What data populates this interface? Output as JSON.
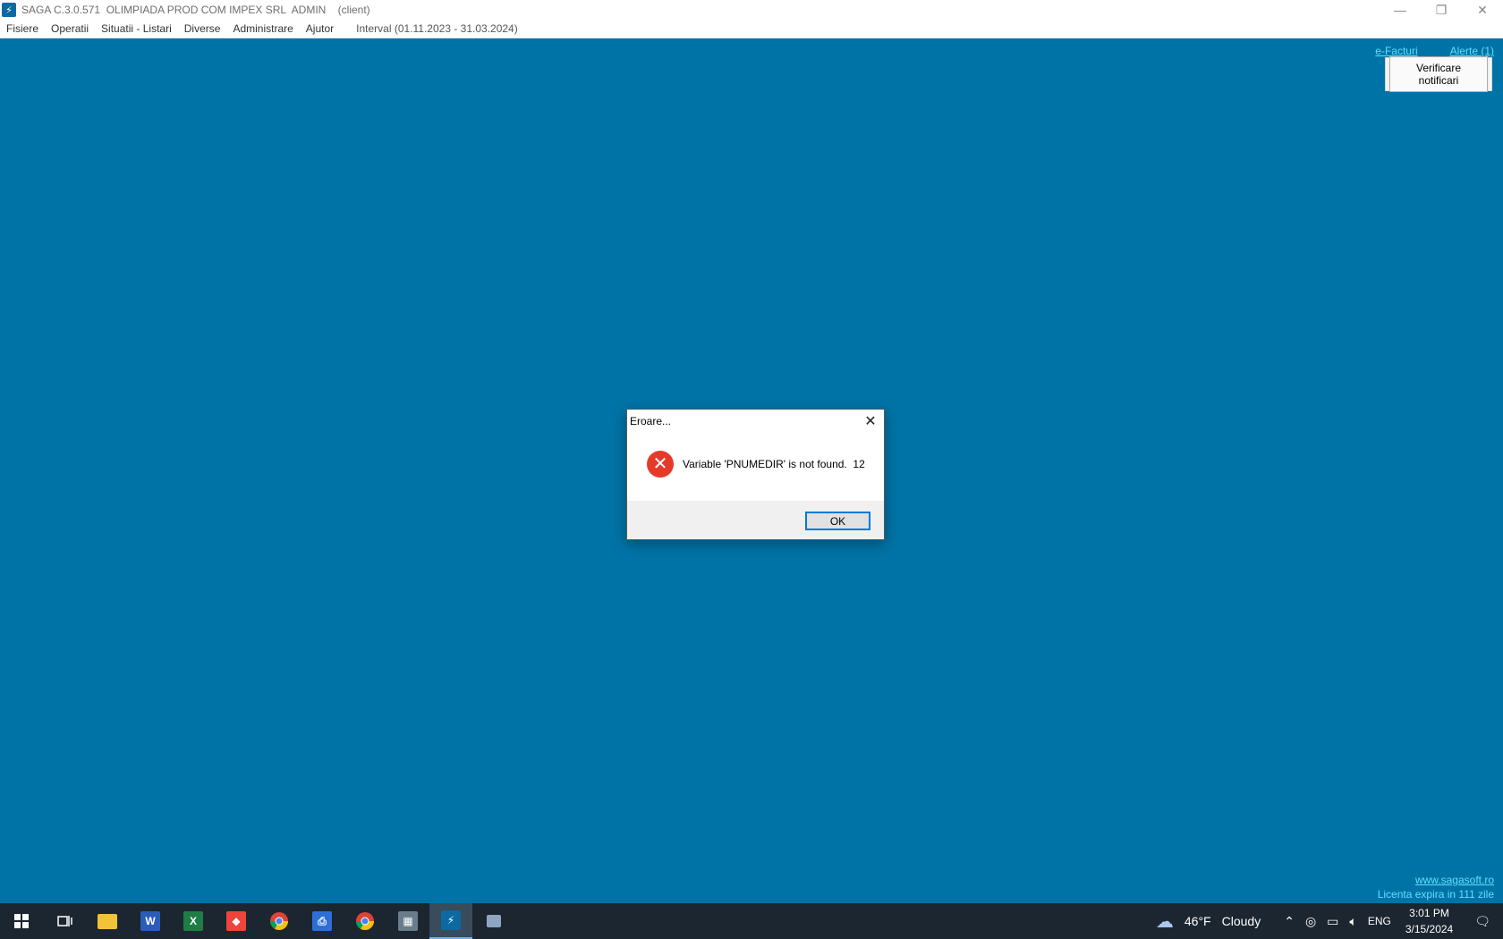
{
  "window": {
    "title": "SAGA C.3.0.571  OLIMPIADA PROD COM IMPEX SRL  ADMIN    (client)",
    "minimize_glyph": "—",
    "restore_glyph": "❐",
    "close_glyph": "✕"
  },
  "menu": {
    "items": [
      "Fisiere",
      "Operatii",
      "Situatii - Listari",
      "Diverse",
      "Administrare",
      "Ajutor"
    ],
    "interval": "Interval (01.11.2023 - 31.03.2024)"
  },
  "desktop": {
    "efacturi_link": "e-Facturi",
    "alerte_link": "Alerte (1)",
    "verif_button": "Verificare notificari",
    "website_link": "www.sagasoft.ro",
    "license_text": "Licenta expira in 111 zile"
  },
  "dialog": {
    "title": "Eroare...",
    "message": "Variable 'PNUMEDIR' is not found.  12",
    "ok_label": "OK",
    "close_glyph": "✕",
    "icon_glyph": "✕"
  },
  "taskbar": {
    "weather_temp": "46°F",
    "weather_desc": "Cloudy",
    "language": "ENG",
    "time": "3:01 PM",
    "date": "3/15/2024"
  },
  "colors": {
    "desktop": "#0073a6",
    "link": "#5ee0ff",
    "error_icon": "#e53a2a",
    "taskbar": "#1b2631"
  }
}
